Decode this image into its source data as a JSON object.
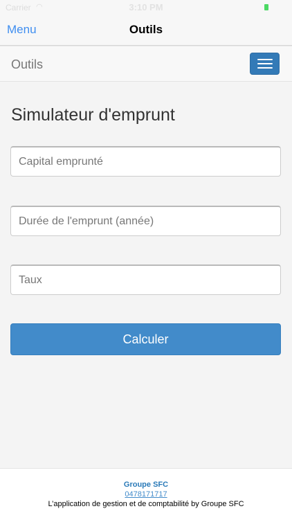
{
  "status_bar": {
    "carrier": "Carrier",
    "wifi_icon": "wifi-icon",
    "time": "3:10 PM",
    "battery_icon": "battery-icon",
    "battery_color": "#4cd964"
  },
  "nav_bar": {
    "back_label": "Menu",
    "title": "Outils"
  },
  "app_navbar": {
    "brand": "Outils",
    "toggle_icon": "hamburger-menu-icon"
  },
  "form": {
    "heading": "Simulateur d'emprunt",
    "fields": [
      {
        "placeholder": "Capital emprunté",
        "value": ""
      },
      {
        "placeholder": "Durée de l'emprunt (année)",
        "value": ""
      },
      {
        "placeholder": "Taux",
        "value": ""
      }
    ],
    "submit_label": "Calculer"
  },
  "footer": {
    "company": "Groupe SFC",
    "phone": "0478171717",
    "tagline": "L’application de gestion et de comptabilité by Groupe SFC"
  },
  "colors": {
    "primary_button": "#428bca",
    "nav_accent": "#3f8ef0",
    "toggle_button": "#337ab7",
    "footer_company": "#2a7ab8"
  }
}
